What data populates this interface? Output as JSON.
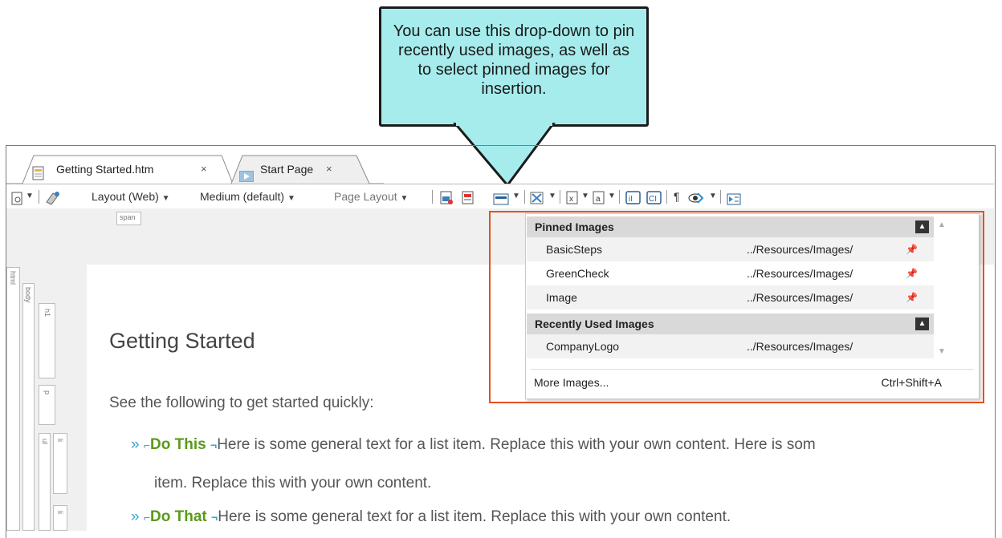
{
  "callout": {
    "text": "You can use this drop-down to pin recently used images, as well as to select pinned images for insertion."
  },
  "tabs": [
    {
      "label": "Getting Started.htm",
      "close": "×"
    },
    {
      "label": "Start Page",
      "close": "×"
    }
  ],
  "toolbar": {
    "layout_label": "Layout (Web)",
    "medium_label": "Medium (default)",
    "page_layout_label": "Page Layout"
  },
  "structure_tags": {
    "span": "span",
    "html": "html",
    "body": "body",
    "h1": "h1",
    "p": "p",
    "ul": "ul",
    "li": "li"
  },
  "document": {
    "heading": "Getting Started",
    "paragraph": "See the following to get started quickly:",
    "list_items": [
      {
        "bold": "Do This",
        "text": "Here is some general text for a list item. Replace this with your own content. Here is som",
        "continuation": "item. Replace this with your own content."
      },
      {
        "bold": "Do That",
        "text": "Here is some general text for a list item. Replace this with your own content."
      }
    ]
  },
  "dropdown": {
    "pinned_header": "Pinned Images",
    "recent_header": "Recently Used Images",
    "pinned_items": [
      {
        "name": "BasicSteps",
        "path": "../Resources/Images/"
      },
      {
        "name": "GreenCheck",
        "path": "../Resources/Images/"
      },
      {
        "name": "Image",
        "path": "../Resources/Images/"
      }
    ],
    "recent_items": [
      {
        "name": "CompanyLogo",
        "path": "../Resources/Images/"
      }
    ],
    "more_label": "More Images...",
    "more_shortcut": "Ctrl+Shift+A"
  },
  "colors": {
    "callout_fill": "#a6ecec",
    "highlight_outline": "#e55020",
    "list_bold": "#5a9a1a",
    "bracket_blue": "#3aa4cc"
  }
}
